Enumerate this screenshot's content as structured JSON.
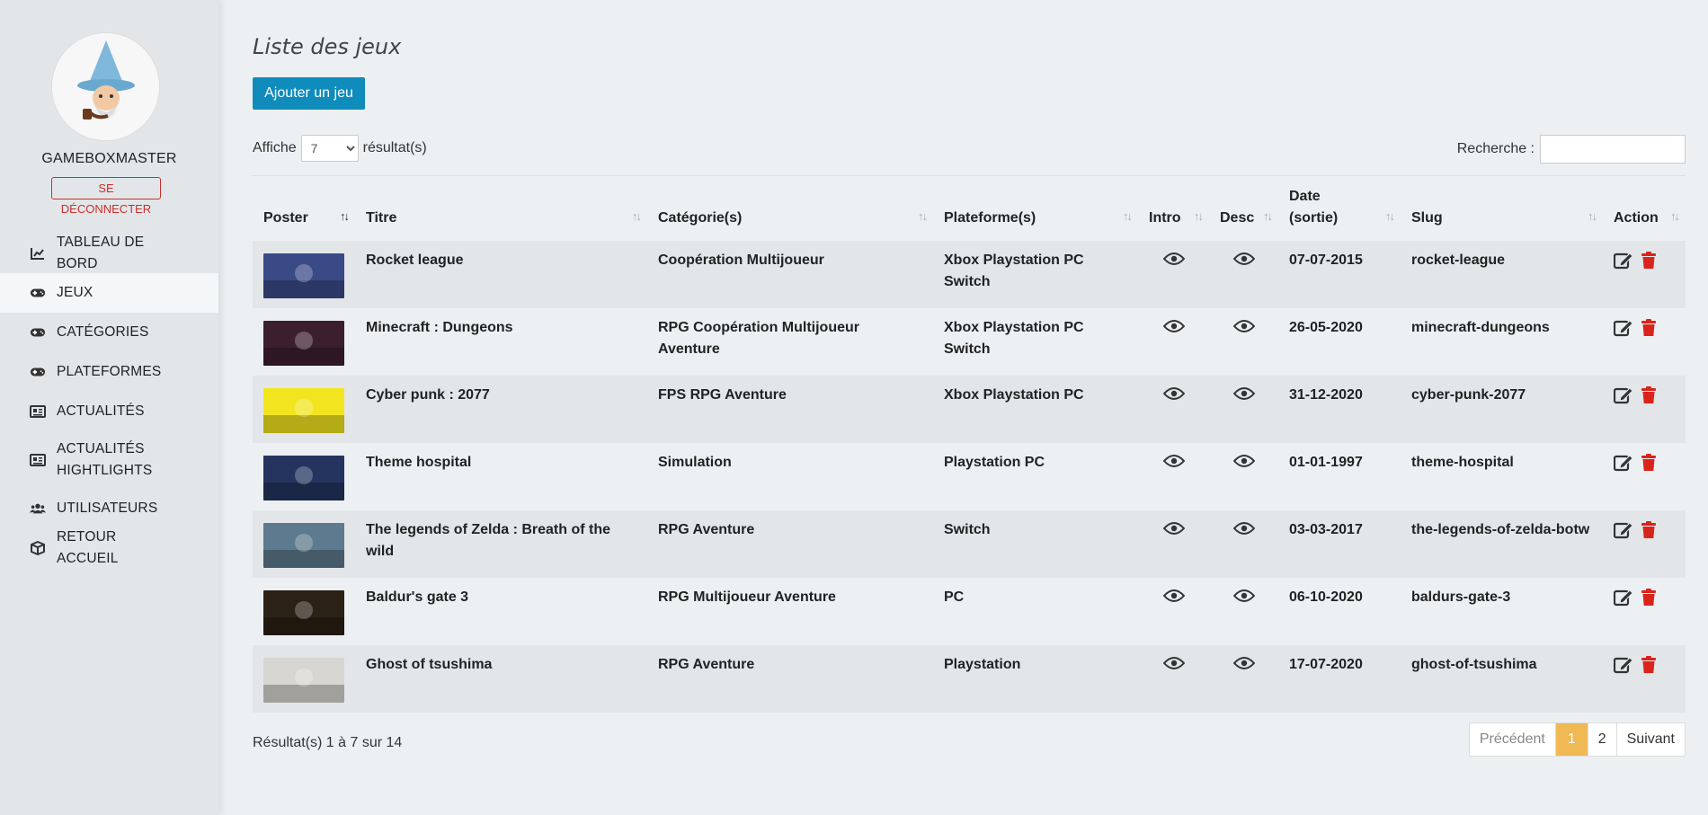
{
  "sidebar": {
    "username": "GAMEBOXMASTER",
    "logout_label": "SE DÉCONNECTER",
    "items": [
      {
        "label": "TABLEAU DE BORD",
        "icon": "chart-line-icon"
      },
      {
        "label": "JEUX",
        "icon": "gamepad-icon"
      },
      {
        "label": "CATÉGORIES",
        "icon": "gamepad-icon"
      },
      {
        "label": "PLATEFORMES",
        "icon": "gamepad-icon"
      },
      {
        "label": "ACTUALITÉS",
        "icon": "newspaper-icon"
      },
      {
        "label": "ACTUALITÉS HIGHTLIGHTS",
        "icon": "newspaper-icon"
      },
      {
        "label": "UTILISATEURS",
        "icon": "users-icon"
      },
      {
        "label": "RETOUR ACCUEIL",
        "icon": "box-icon"
      }
    ]
  },
  "main": {
    "title": "Liste des jeux",
    "add_button": "Ajouter un jeu",
    "length": {
      "prefix": "Affiche",
      "value": "7",
      "suffix": "résultat(s)"
    },
    "search": {
      "label": "Recherche :",
      "value": ""
    },
    "columns": [
      "Poster",
      "Titre",
      "Catégorie(s)",
      "Plateforme(s)",
      "Intro",
      "Desc",
      "Date (sortie)",
      "Slug",
      "Action"
    ],
    "rows": [
      {
        "title": "Rocket league",
        "categories": "Coopération Multijoueur",
        "platforms": "Xbox Playstation PC Switch",
        "date": "07-07-2015",
        "slug": "rocket-league",
        "poster_color": "#3a4a86"
      },
      {
        "title": "Minecraft : Dungeons",
        "categories": "RPG Coopération Multijoueur Aventure",
        "platforms": "Xbox Playstation PC Switch",
        "date": "26-05-2020",
        "slug": "minecraft-dungeons",
        "poster_color": "#3b1f2f"
      },
      {
        "title": "Cyber punk : 2077",
        "categories": "FPS RPG Aventure",
        "platforms": "Xbox Playstation PC",
        "date": "31-12-2020",
        "slug": "cyber-punk-2077",
        "poster_color": "#f2e51f"
      },
      {
        "title": "Theme hospital",
        "categories": "Simulation",
        "platforms": "Playstation PC",
        "date": "01-01-1997",
        "slug": "theme-hospital",
        "poster_color": "#24345e"
      },
      {
        "title": "The legends of Zelda : Breath of the wild",
        "categories": "RPG Aventure",
        "platforms": "Switch",
        "date": "03-03-2017",
        "slug": "the-legends-of-zelda-botw",
        "poster_color": "#5d7a8e"
      },
      {
        "title": "Baldur's gate 3",
        "categories": "RPG Multijoueur Aventure",
        "platforms": "PC",
        "date": "06-10-2020",
        "slug": "baldurs-gate-3",
        "poster_color": "#2b2115"
      },
      {
        "title": "Ghost of tsushima",
        "categories": "RPG Aventure",
        "platforms": "Playstation",
        "date": "17-07-2020",
        "slug": "ghost-of-tsushima",
        "poster_color": "#d8d6d2"
      }
    ],
    "info": "Résultat(s) 1 à 7 sur 14",
    "pager": {
      "prev": "Précédent",
      "pages": [
        "1",
        "2"
      ],
      "next": "Suivant"
    }
  },
  "colors": {
    "primary": "#0f8cbc",
    "danger": "#d9241c",
    "accent": "#f0b954"
  }
}
